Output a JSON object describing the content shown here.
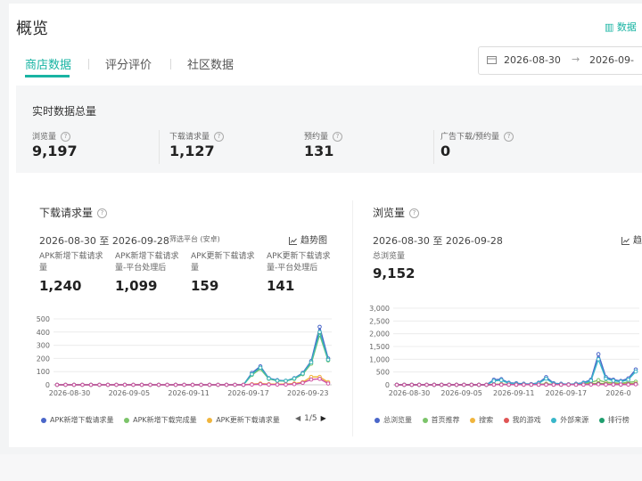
{
  "page": {
    "title": "概览",
    "top_right_link": "数据",
    "tabs": [
      {
        "label": "商店数据"
      },
      {
        "label": "评分评价"
      },
      {
        "label": "社区数据"
      }
    ],
    "date_picker": {
      "start": "2026-08-30",
      "end": "2026-09-"
    }
  },
  "realtime": {
    "title": "实时数据总量",
    "metrics": [
      {
        "label": "浏览量",
        "value": "9,197"
      },
      {
        "label": "下载请求量",
        "value": "1,127"
      },
      {
        "label": "预约量",
        "value": "131"
      },
      {
        "label": "广告下载/预约量",
        "value": "0"
      }
    ]
  },
  "downloads": {
    "title": "下载请求量",
    "date_range": "2026-08-30 至 2026-09-28",
    "filter": "筛选平台 (安卓)",
    "trend_label": "趋势图",
    "metrics": [
      {
        "label": "APK新增下载请求量",
        "value": "1,240"
      },
      {
        "label": "APK新增下载请求量-平台处理后",
        "value": "1,099"
      },
      {
        "label": "APK更新下载请求量",
        "value": "159"
      },
      {
        "label": "APK更新下载请求量-平台处理后",
        "value": "141"
      }
    ],
    "legend": [
      "APK新增下载请求量",
      "APK新增下载完成量",
      "APK更新下载请求量"
    ],
    "pager": "1/5"
  },
  "views": {
    "title": "浏览量",
    "date_range": "2026-08-30 至 2026-09-28",
    "trend_label": "趋",
    "metric": {
      "label": "总浏览量",
      "value": "9,152"
    },
    "legend": [
      "总浏览量",
      "首页推荐",
      "搜索",
      "我的游戏",
      "外部来源",
      "排行榜"
    ]
  },
  "colors": {
    "accent": "#19b4a3"
  },
  "chart_data": [
    {
      "type": "line",
      "title": "下载请求量",
      "ylim": [
        0,
        500
      ],
      "yticks": [
        0,
        100,
        200,
        300,
        400,
        500
      ],
      "x": [
        "2026-08-30",
        "2026-08-31",
        "2026-09-01",
        "2026-09-02",
        "2026-09-03",
        "2026-09-04",
        "2026-09-05",
        "2026-09-06",
        "2026-09-07",
        "2026-09-08",
        "2026-09-09",
        "2026-09-10",
        "2026-09-11",
        "2026-09-12",
        "2026-09-13",
        "2026-09-14",
        "2026-09-15",
        "2026-09-16",
        "2026-09-17",
        "2026-09-18",
        "2026-09-19",
        "2026-09-20",
        "2026-09-21",
        "2026-09-22",
        "2026-09-23",
        "2026-09-24",
        "2026-09-25",
        "2026-09-26",
        "2026-09-27",
        "2026-09-28"
      ],
      "xtick_labels": [
        "2026-08-30",
        "2026-09-05",
        "2026-09-11",
        "2026-09-17",
        "2026-09-23"
      ],
      "series": [
        {
          "name": "APK新增下载请求量",
          "color": "#4a66c9",
          "values": [
            0,
            0,
            0,
            0,
            0,
            0,
            0,
            0,
            0,
            0,
            0,
            0,
            0,
            0,
            0,
            0,
            0,
            0,
            0,
            0,
            0,
            0,
            0,
            90,
            140,
            50,
            35,
            30,
            50,
            90,
            180,
            440,
            200
          ]
        },
        {
          "name": "APK新增下载完成量",
          "color": "#7cc46a",
          "values": [
            0,
            0,
            0,
            0,
            0,
            0,
            0,
            0,
            0,
            0,
            0,
            0,
            0,
            0,
            0,
            0,
            0,
            0,
            0,
            0,
            0,
            0,
            0,
            75,
            120,
            45,
            30,
            28,
            45,
            80,
            160,
            380,
            185
          ]
        },
        {
          "name": "APK更新下载请求量",
          "color": "#f0b53d",
          "values": [
            0,
            0,
            0,
            0,
            0,
            0,
            0,
            0,
            0,
            0,
            0,
            0,
            0,
            0,
            0,
            0,
            0,
            0,
            0,
            0,
            0,
            0,
            0,
            5,
            10,
            5,
            5,
            5,
            10,
            20,
            60,
            60,
            20
          ]
        },
        {
          "name": "",
          "color": "#38b6b9",
          "values": [
            0,
            0,
            0,
            0,
            0,
            0,
            0,
            0,
            0,
            0,
            0,
            0,
            0,
            0,
            0,
            0,
            0,
            0,
            0,
            0,
            0,
            0,
            0,
            80,
            130,
            48,
            32,
            30,
            48,
            85,
            170,
            400,
            190
          ]
        },
        {
          "name": "",
          "color": "#d04fa2",
          "values": [
            0,
            0,
            0,
            0,
            0,
            0,
            0,
            0,
            0,
            0,
            0,
            0,
            0,
            0,
            0,
            0,
            0,
            0,
            0,
            0,
            0,
            0,
            0,
            2,
            5,
            2,
            2,
            2,
            5,
            15,
            40,
            45,
            10
          ]
        }
      ]
    },
    {
      "type": "line",
      "title": "浏览量",
      "ylim": [
        0,
        3000
      ],
      "yticks": [
        0,
        500,
        1000,
        1500,
        2000,
        2500,
        3000
      ],
      "ytick_labels": [
        "0",
        "500",
        "1,000",
        "1,500",
        "2,000",
        "2,500",
        "3,000"
      ],
      "xtick_labels": [
        "2026-08-30",
        "2026-09-05",
        "2026-09-11",
        "2026-09-17",
        "2026-0"
      ],
      "series": [
        {
          "name": "总浏览量",
          "color": "#4a66c9",
          "values": [
            0,
            0,
            0,
            0,
            0,
            0,
            0,
            0,
            0,
            0,
            0,
            0,
            0,
            200,
            220,
            80,
            60,
            40,
            30,
            80,
            300,
            60,
            40,
            20,
            40,
            80,
            200,
            1200,
            300,
            200,
            150,
            250,
            600
          ]
        },
        {
          "name": "首页推荐",
          "color": "#7cc46a",
          "values": [
            0,
            0,
            0,
            0,
            0,
            0,
            0,
            0,
            0,
            0,
            0,
            0,
            0,
            20,
            30,
            20,
            10,
            10,
            10,
            20,
            40,
            20,
            10,
            10,
            20,
            40,
            100,
            180,
            100,
            80,
            60,
            100,
            120
          ]
        },
        {
          "name": "搜索",
          "color": "#f0b53d",
          "values": [
            0,
            0,
            0,
            0,
            0,
            0,
            0,
            0,
            0,
            0,
            0,
            0,
            0,
            10,
            20,
            10,
            5,
            5,
            5,
            10,
            20,
            10,
            5,
            5,
            10,
            20,
            40,
            60,
            40,
            30,
            30,
            40,
            50
          ]
        },
        {
          "name": "我的游戏",
          "color": "#e05555",
          "values": [
            0,
            0,
            0,
            0,
            0,
            0,
            0,
            0,
            0,
            0,
            0,
            0,
            0,
            5,
            10,
            5,
            5,
            5,
            5,
            5,
            10,
            5,
            5,
            5,
            10,
            10,
            20,
            30,
            20,
            20,
            20,
            20,
            30
          ]
        },
        {
          "name": "外部来源",
          "color": "#38b6c9",
          "values": [
            0,
            0,
            0,
            0,
            0,
            0,
            0,
            0,
            0,
            0,
            0,
            0,
            0,
            150,
            180,
            60,
            40,
            30,
            20,
            60,
            240,
            40,
            30,
            10,
            30,
            60,
            160,
            1000,
            240,
            160,
            120,
            200,
            520
          ]
        },
        {
          "name": "排行榜",
          "color": "#1f9e6e",
          "values": [
            0,
            0,
            0,
            0,
            0,
            0,
            0,
            0,
            0,
            0,
            0,
            0,
            0,
            5,
            10,
            5,
            5,
            5,
            5,
            5,
            10,
            5,
            5,
            5,
            5,
            10,
            20,
            40,
            20,
            10,
            10,
            20,
            30
          ]
        },
        {
          "name": "",
          "color": "#d04fa2",
          "values": [
            0,
            0,
            0,
            0,
            0,
            0,
            0,
            0,
            0,
            0,
            0,
            0,
            0,
            5,
            5,
            5,
            5,
            5,
            5,
            5,
            5,
            5,
            5,
            5,
            5,
            5,
            10,
            20,
            10,
            10,
            10,
            10,
            20
          ]
        }
      ]
    }
  ]
}
